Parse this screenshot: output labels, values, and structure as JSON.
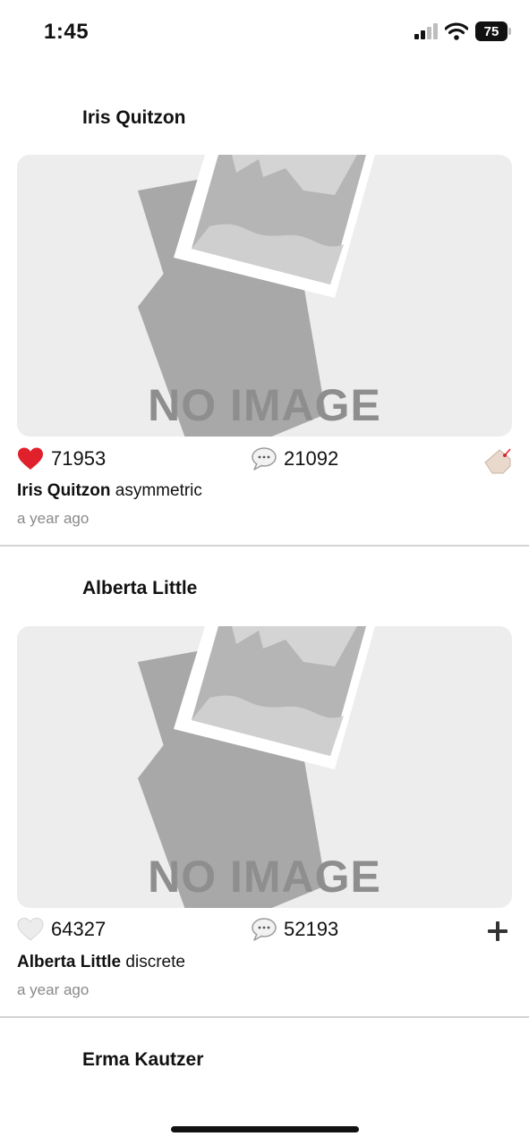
{
  "status": {
    "time": "1:45",
    "battery": "75"
  },
  "posts": [
    {
      "author": "Iris Quitzon",
      "image_text": "NO IMAGE",
      "likes": "71953",
      "liked": true,
      "comments": "21092",
      "caption_author": "Iris Quitzon",
      "caption_text": "asymmetric",
      "time": "a year ago",
      "right_icon": "price-tag-icon"
    },
    {
      "author": "Alberta Little",
      "image_text": "NO IMAGE",
      "likes": "64327",
      "liked": false,
      "comments": "52193",
      "caption_author": "Alberta Little",
      "caption_text": "discrete",
      "time": "a year ago",
      "right_icon": "plus-icon"
    },
    {
      "author": "Erma Kautzer"
    }
  ],
  "colors": {
    "heart_liked": "#e0202a",
    "heart_unliked": "#e6e6e6",
    "placeholder_bg": "#ededed"
  }
}
